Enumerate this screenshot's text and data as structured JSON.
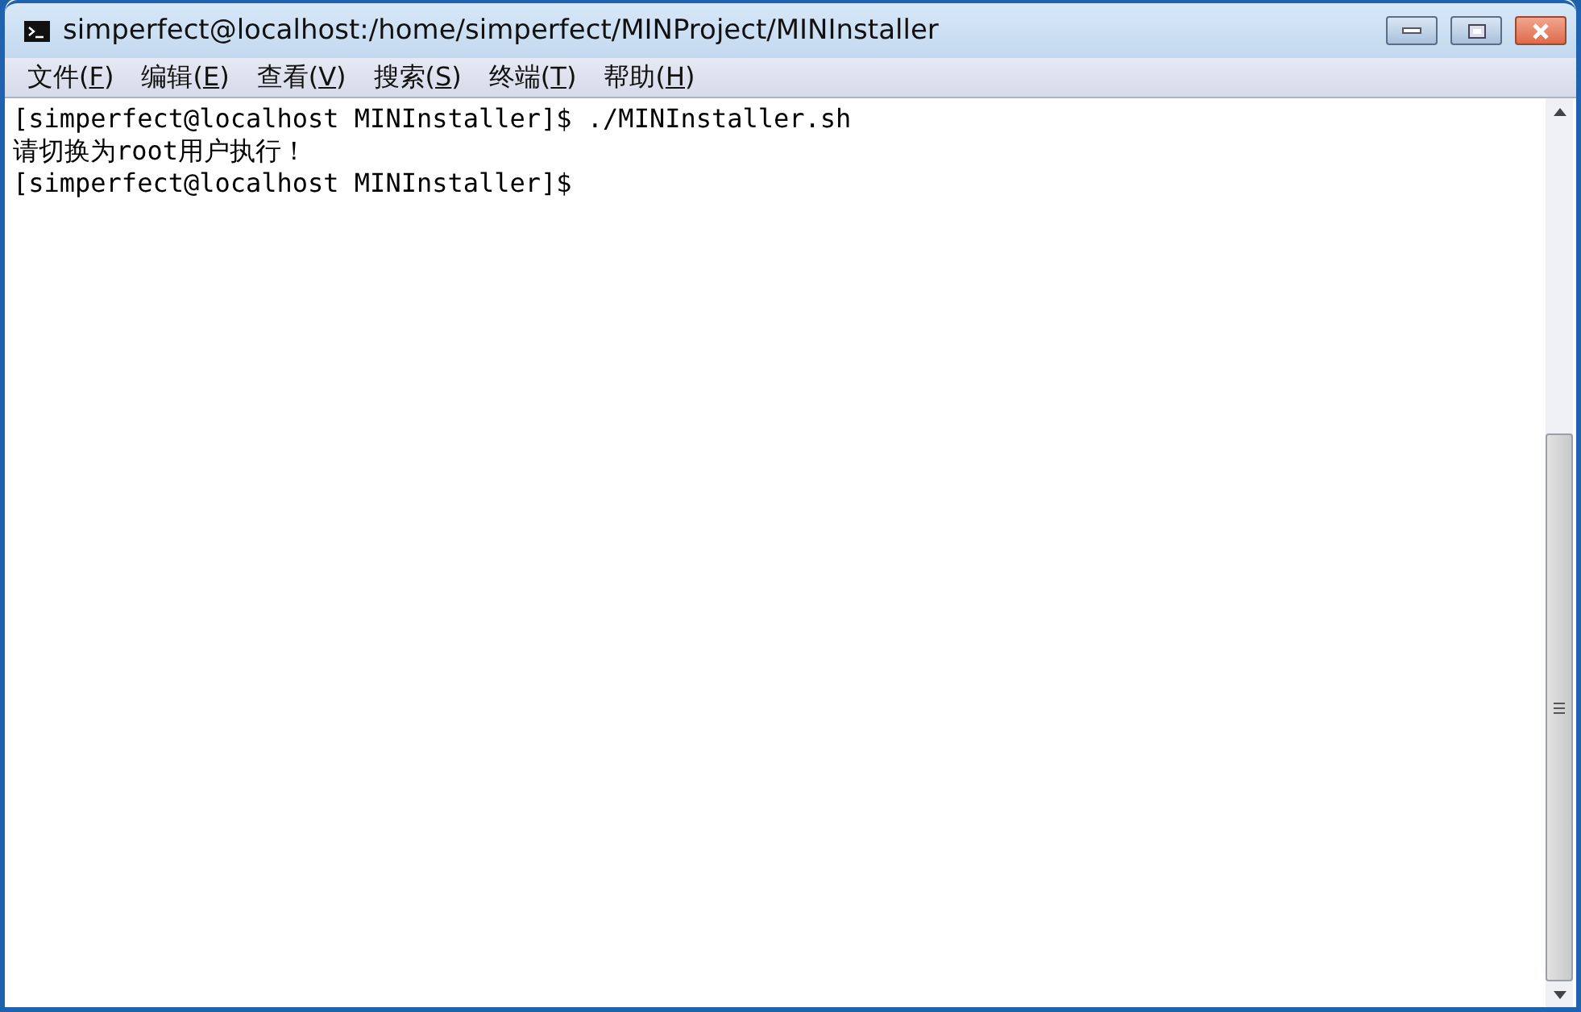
{
  "window": {
    "title": "simperfect@localhost:/home/simperfect/MINProject/MINInstaller"
  },
  "menu": [
    {
      "before": "文件(",
      "key": "F",
      "after": ")"
    },
    {
      "before": "编辑(",
      "key": "E",
      "after": ")"
    },
    {
      "before": "查看(",
      "key": "V",
      "after": ")"
    },
    {
      "before": "搜索(",
      "key": "S",
      "after": ")"
    },
    {
      "before": "终端(",
      "key": "T",
      "after": ")"
    },
    {
      "before": "帮助(",
      "key": "H",
      "after": ")"
    }
  ],
  "terminal": {
    "lines": [
      "[simperfect@localhost MINInstaller]$ ./MINInstaller.sh",
      "请切换为root用户执行！",
      "[simperfect@localhost MINInstaller]$"
    ]
  }
}
